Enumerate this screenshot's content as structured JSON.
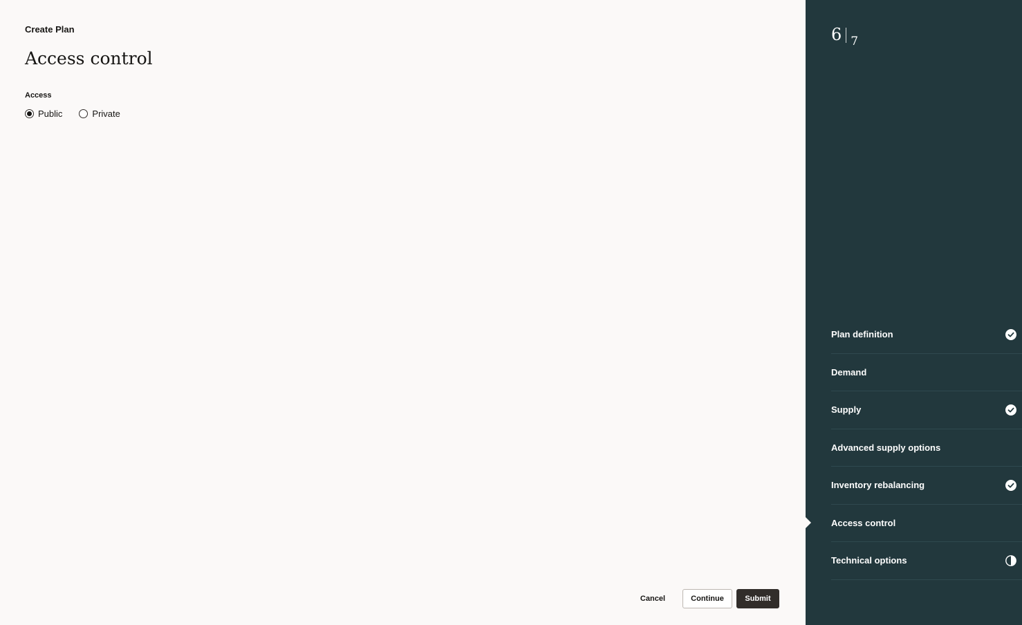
{
  "header": {
    "breadcrumb": "Create Plan",
    "title": "Access control"
  },
  "form": {
    "access_label": "Access",
    "options": [
      {
        "label": "Public",
        "selected": true
      },
      {
        "label": "Private",
        "selected": false
      }
    ]
  },
  "footer": {
    "cancel_label": "Cancel",
    "continue_label": "Continue",
    "submit_label": "Submit"
  },
  "sidebar": {
    "current_step": "6",
    "total_steps": "7",
    "steps": [
      {
        "label": "Plan definition",
        "status": "complete",
        "icon": "check-circle-icon"
      },
      {
        "label": "Demand",
        "status": "none",
        "icon": ""
      },
      {
        "label": "Supply",
        "status": "complete",
        "icon": "check-circle-icon"
      },
      {
        "label": "Advanced supply options",
        "status": "none",
        "icon": ""
      },
      {
        "label": "Inventory rebalancing",
        "status": "complete",
        "icon": "check-circle-icon"
      },
      {
        "label": "Access control",
        "status": "active",
        "icon": ""
      },
      {
        "label": "Technical options",
        "status": "partial",
        "icon": "half-circle-icon"
      }
    ]
  },
  "colors": {
    "sidebar_bg": "#22383d",
    "page_bg": "#fbf9f8",
    "primary_button": "#312d2a"
  }
}
